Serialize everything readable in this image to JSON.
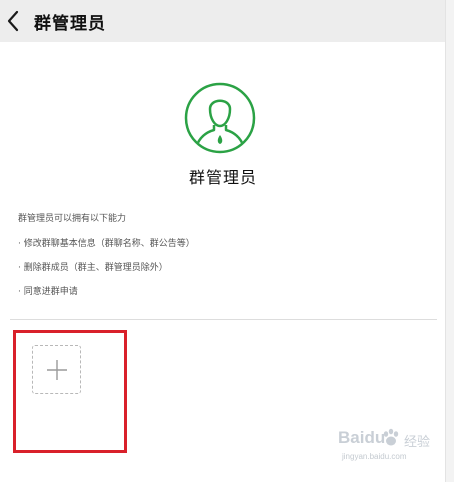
{
  "header": {
    "title": "群管理员",
    "back_icon": "chevron-left-icon"
  },
  "role": {
    "name": "群管理员",
    "avatar_icon": "person-avatar-icon",
    "accent_color": "#2ba245"
  },
  "abilities": {
    "intro": "群管理员可以拥有以下能力",
    "items": [
      "· 修改群聊基本信息（群聊名称、群公告等）",
      "· 删除群成员（群主、群管理员除外）",
      "· 同意进群申请"
    ]
  },
  "add_member": {
    "icon": "plus-icon"
  },
  "annotation": {
    "highlight_color": "#d9202a"
  },
  "watermark": {
    "logo_text": "Baidu",
    "cn_text": "经验",
    "url": "jingyan.baidu.com"
  }
}
